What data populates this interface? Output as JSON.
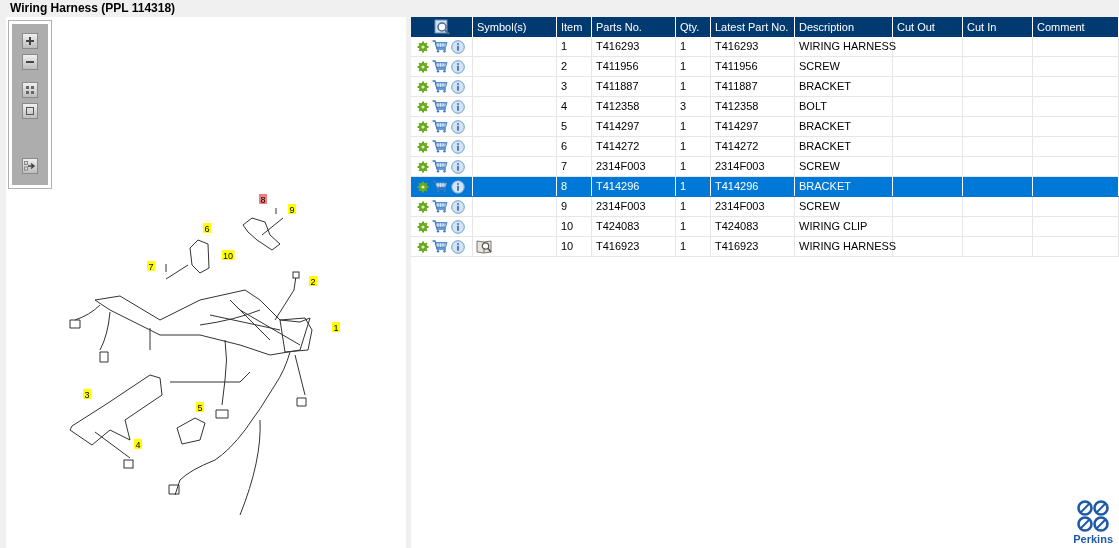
{
  "title": "Wiring Harness (PPL 114318)",
  "diagram": {
    "callouts": [
      {
        "label": "8",
        "selected": true
      },
      {
        "label": "9",
        "selected": false
      },
      {
        "label": "6",
        "selected": false
      },
      {
        "label": "10",
        "selected": false
      },
      {
        "label": "7",
        "selected": false
      },
      {
        "label": "2",
        "selected": false
      },
      {
        "label": "1",
        "selected": false
      },
      {
        "label": "3",
        "selected": false
      },
      {
        "label": "5",
        "selected": false
      },
      {
        "label": "4",
        "selected": false
      }
    ]
  },
  "table": {
    "columns": [
      "Symbol(s)",
      "Item",
      "Parts No.",
      "Qty.",
      "Latest Part No.",
      "Description",
      "Cut Out",
      "Cut In",
      "Comment"
    ],
    "rows": [
      {
        "symbol": false,
        "item": "1",
        "parts_no": "T416293",
        "qty": "1",
        "latest": "T416293",
        "description": "WIRING HARNESS",
        "selected": false
      },
      {
        "symbol": false,
        "item": "2",
        "parts_no": "T411956",
        "qty": "1",
        "latest": "T411956",
        "description": "SCREW",
        "selected": false
      },
      {
        "symbol": false,
        "item": "3",
        "parts_no": "T411887",
        "qty": "1",
        "latest": "T411887",
        "description": "BRACKET",
        "selected": false
      },
      {
        "symbol": false,
        "item": "4",
        "parts_no": "T412358",
        "qty": "3",
        "latest": "T412358",
        "description": "BOLT",
        "selected": false
      },
      {
        "symbol": false,
        "item": "5",
        "parts_no": "T414297",
        "qty": "1",
        "latest": "T414297",
        "description": "BRACKET",
        "selected": false
      },
      {
        "symbol": false,
        "item": "6",
        "parts_no": "T414272",
        "qty": "1",
        "latest": "T414272",
        "description": "BRACKET",
        "selected": false
      },
      {
        "symbol": false,
        "item": "7",
        "parts_no": "2314F003",
        "qty": "1",
        "latest": "2314F003",
        "description": "SCREW",
        "selected": false
      },
      {
        "symbol": false,
        "item": "8",
        "parts_no": "T414296",
        "qty": "1",
        "latest": "T414296",
        "description": "BRACKET",
        "selected": true
      },
      {
        "symbol": false,
        "item": "9",
        "parts_no": "2314F003",
        "qty": "1",
        "latest": "2314F003",
        "description": "SCREW",
        "selected": false
      },
      {
        "symbol": false,
        "item": "10",
        "parts_no": "T424083",
        "qty": "1",
        "latest": "T424083",
        "description": "WIRING CLIP",
        "selected": false
      },
      {
        "symbol": true,
        "item": "10",
        "parts_no": "T416923",
        "qty": "1",
        "latest": "T416923",
        "description": "WIRING HARNESS",
        "selected": false
      }
    ]
  },
  "logo": {
    "text": "Perkins"
  }
}
